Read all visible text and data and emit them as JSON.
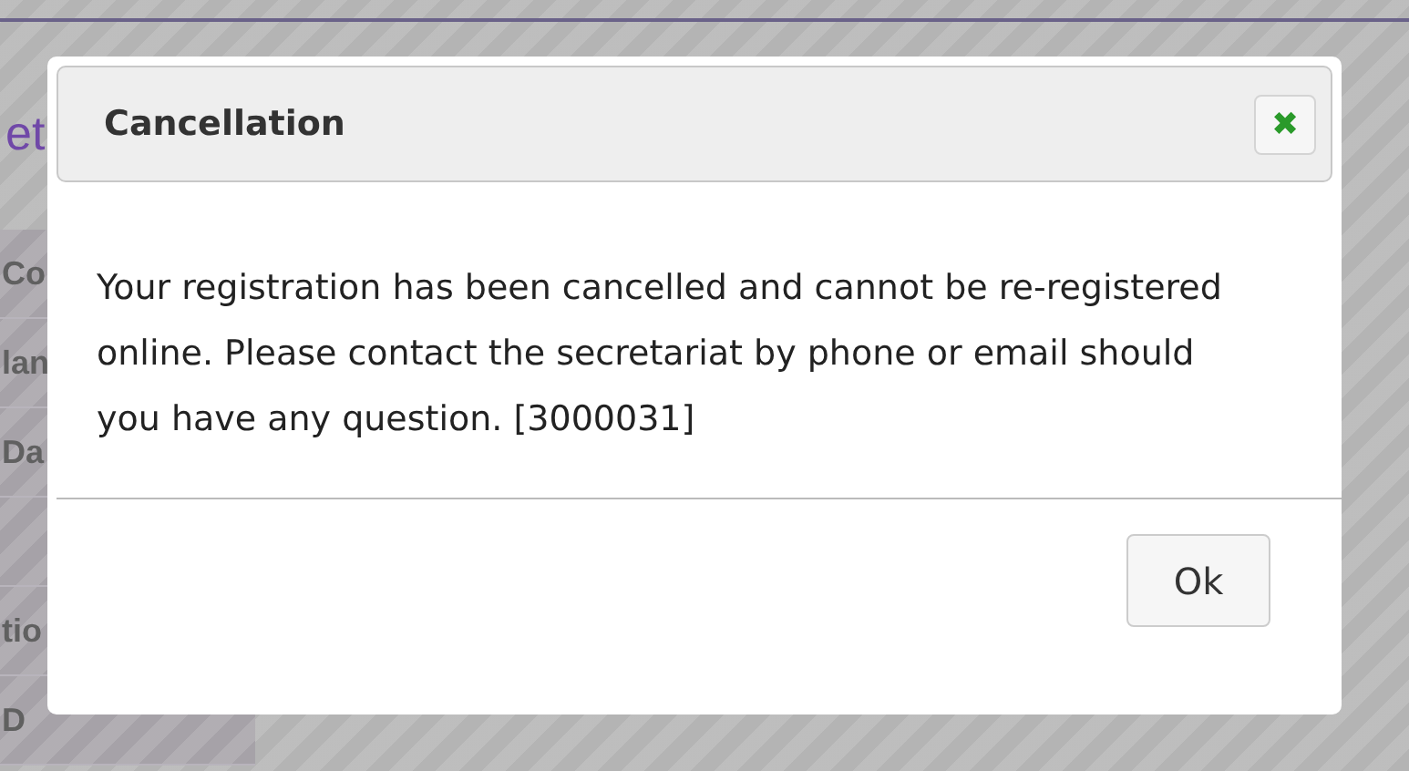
{
  "background": {
    "heading": "et",
    "rows": [
      {
        "label": "Co"
      },
      {
        "label": "lan"
      },
      {
        "label": "Da"
      },
      {
        "label": ""
      },
      {
        "label": "tio"
      },
      {
        "label": "D"
      }
    ]
  },
  "dialog": {
    "title": "Cancellation",
    "close": "✖",
    "message": "Your registration has been cancelled and cannot be re-registered online. Please contact the secretariat by phone or email should you have any question. [3000031]",
    "buttons": [
      "Ok"
    ]
  }
}
